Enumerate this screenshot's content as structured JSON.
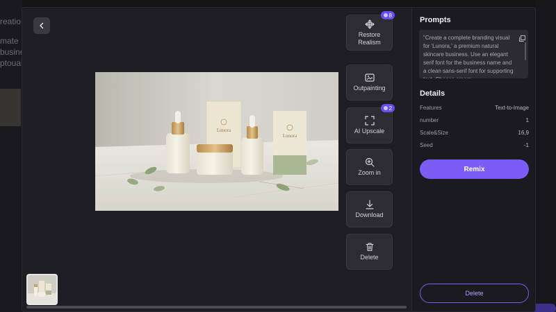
{
  "background": {
    "left_lines": [
      "reatio",
      "mate",
      "busine",
      "ptouals"
    ]
  },
  "tools": [
    {
      "id": "restore",
      "label_lines": [
        "Restore",
        "Realism"
      ],
      "badge": "8"
    },
    {
      "id": "outpaint",
      "label_lines": [
        "Outpainting"
      ],
      "badge": ""
    },
    {
      "id": "upscale",
      "label_lines": [
        "AI Upscale"
      ],
      "badge": "2"
    },
    {
      "id": "zoom",
      "label_lines": [
        "Zoom in"
      ],
      "badge": ""
    },
    {
      "id": "download",
      "label_lines": [
        "Download"
      ],
      "badge": ""
    },
    {
      "id": "delete",
      "label_lines": [
        "Delete"
      ],
      "badge": ""
    }
  ],
  "panel": {
    "prompts_title": "Prompts",
    "prompt_text": "\"Create a complete branding visual for 'Lunora,' a premium natural skincare business. Use an elegant serif font for the business name and a clean sans-serif font for supporting text. Choose cream",
    "details_title": "Details",
    "details": [
      {
        "key": "Features",
        "value": "Text-to-Image"
      },
      {
        "key": "number",
        "value": "1"
      },
      {
        "key": "Scale&Size",
        "value": "16,9"
      },
      {
        "key": "Seed",
        "value": "-1"
      }
    ],
    "remix_label": "Remix",
    "delete_label": "Delete"
  },
  "image": {
    "brand_text": "Lunora"
  },
  "colors": {
    "accent": "#7b5cf5",
    "badge": "#6b4cf0",
    "modal_bg": "#1e1d24",
    "panel_bg": "#1b1a20"
  }
}
